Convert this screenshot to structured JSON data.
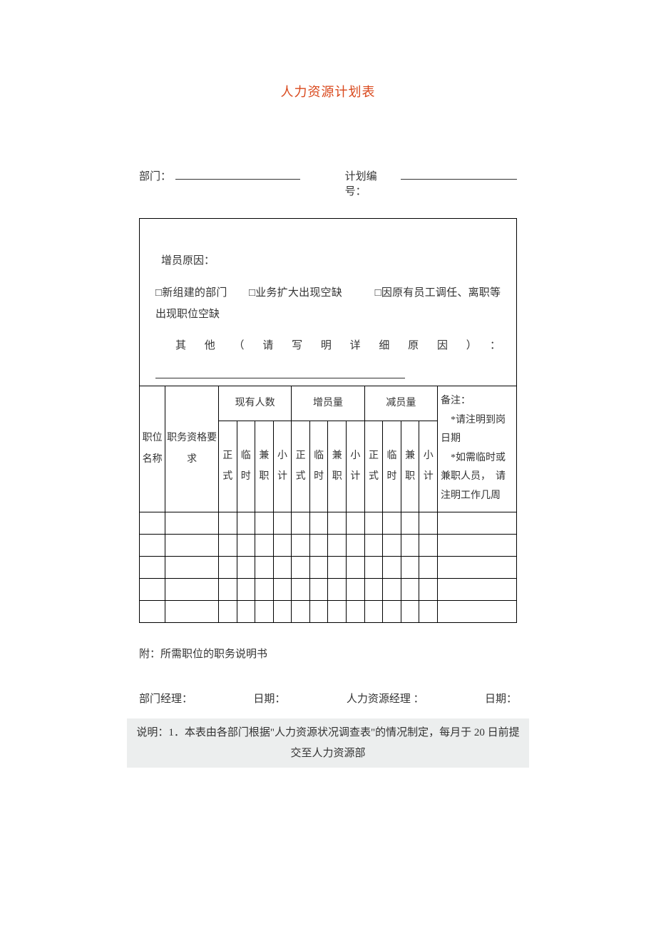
{
  "title": "人力资源计划表",
  "header": {
    "dept_label": "部门：",
    "plan_label": "计划编号："
  },
  "reason": {
    "label": "增员原因：",
    "options_line": "□新组建的部门　　□业务扩大出现空缺　　　□因原有员工调任、离职等出现职位空缺",
    "other_label": "其他（请写明详细原因）："
  },
  "table": {
    "col_position": "职位名称",
    "col_requirement": "职务资格要求",
    "group_current": "现有人数",
    "group_increase": "增员量",
    "group_decrease": "减员量",
    "sub_formal": "正式",
    "sub_temp": "临时",
    "sub_parttime": "兼职",
    "sub_subtotal": "小计",
    "notes_label": "备注：",
    "notes_line1": "　*请注明到岗日期",
    "notes_line2": "　*如需临时或兼职人员，　请注明工作几周"
  },
  "appendix": "附：所需职位的职务说明书",
  "signatures": {
    "dept_mgr": "部门经理：",
    "date1": "日期：",
    "hr_mgr": "人力资源经理 ：",
    "date2": "日期："
  },
  "footer": "说明：1．本表由各部门根据\"人力资源状况调查表\"的情况制定，每月于 20 日前提交至人力资源部"
}
